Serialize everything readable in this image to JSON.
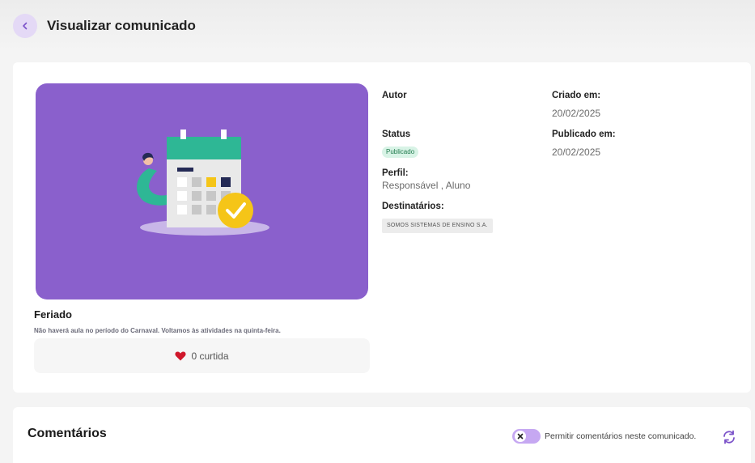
{
  "header": {
    "title": "Visualizar comunicado",
    "back_icon": "chevron-left-icon"
  },
  "post": {
    "title": "Feriado",
    "description": "Não haverá aula no período do Carnaval. Voltamos às atividades na quinta-feira.",
    "likes": "0 curtida",
    "like_icon": "heart-icon"
  },
  "details": {
    "author_label": "Autor",
    "status_label": "Status",
    "status_value": "Publicado",
    "profile_label": "Perfil:",
    "profile_value": "Responsável , Aluno",
    "recipients_label": "Destinatários:",
    "recipient": "SOMOS SISTEMAS DE ENSINO S.A.",
    "created_label": "Criado em:",
    "created_value": "20/02/2025",
    "published_label": "Publicado em:",
    "published_value": "20/02/2025"
  },
  "comments": {
    "title": "Comentários",
    "toggle_label": "Permitir comentários neste comunicado.",
    "toggle_state": "off",
    "refresh_icon": "refresh-icon"
  },
  "colors": {
    "accent": "#8a60cc",
    "toggle": "#c6a8f2",
    "status_bg": "#d8f3e6",
    "heart": "#d0182c",
    "annotation_arrow": "#f07020"
  }
}
